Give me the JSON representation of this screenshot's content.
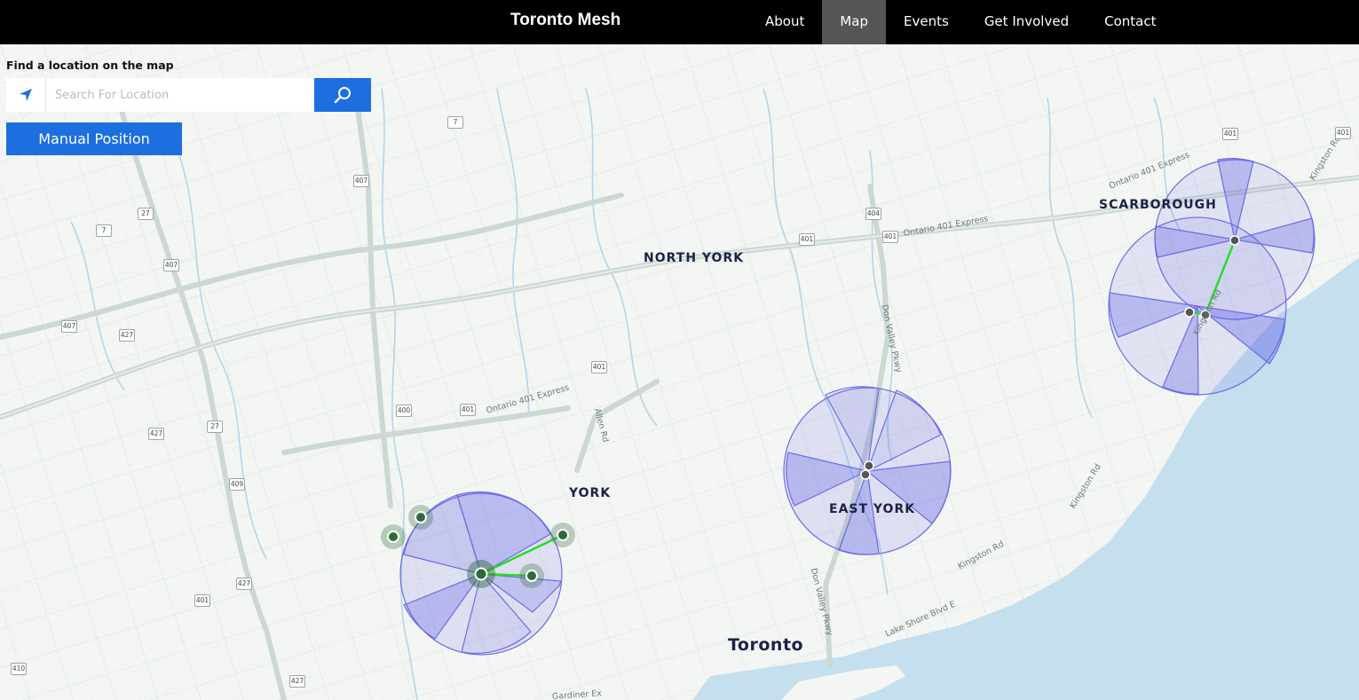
{
  "brand": "Toronto Mesh",
  "nav": [
    {
      "label": "About",
      "active": false
    },
    {
      "label": "Map",
      "active": true
    },
    {
      "label": "Events",
      "active": false
    },
    {
      "label": "Get Involved",
      "active": false
    },
    {
      "label": "Contact",
      "active": false
    }
  ],
  "locator": {
    "heading": "Find a location on the map",
    "placeholder": "Search For Location",
    "value": "",
    "manual_button": "Manual Position",
    "locate_icon": "navigation-arrow-icon",
    "search_icon": "search-icon"
  },
  "map": {
    "places": {
      "north_york": "NORTH YORK",
      "york": "YORK",
      "east_york": "EAST YORK",
      "scarborough": "SCARBOROUGH",
      "toronto": "Toronto"
    },
    "roads": {
      "ontario_401_w": "Ontario 401 Express",
      "ontario_401_e": "Ontario 401 Express",
      "ontario_401_ne": "Ontario 401 Express",
      "allen_rd": "Allen Rd",
      "don_valley_n": "Don Valley Pkwy",
      "don_valley_s": "Don Valley Pkwy",
      "kingston_rd_1": "Kingston Rd",
      "kingston_rd_2": "Kingston Rd",
      "kingston_rd_3": "Kingston Rd",
      "kingston_rd_4": "Kingston Rd",
      "lake_shore": "Lake Shore Blvd E",
      "gardiner": "Gardiner Ex"
    },
    "shields": {
      "s7a": "7",
      "s407a": "407",
      "s27a": "27",
      "s7b": "7",
      "s407b": "407",
      "s407c": "407",
      "s427a": "427",
      "s400": "400",
      "s401a": "401",
      "s401b": "401",
      "s427b": "427",
      "s27b": "27",
      "s409": "409",
      "s427c": "427",
      "s401c": "401",
      "s410": "410",
      "s427d": "427",
      "s404": "404",
      "s401d": "401",
      "s401e": "401",
      "s401f": "401",
      "s401g": "401"
    },
    "colors": {
      "land": "#f4f6f4",
      "road": "#d9e2dd",
      "highway": "#cdd9d3",
      "water": "#c4dfee",
      "coverage_fill": "#5c5ce6",
      "coverage_stroke": "#6b6be8",
      "link": "#22dd22",
      "node_active": "#2f6b3a",
      "node_dark": "#555555"
    }
  }
}
